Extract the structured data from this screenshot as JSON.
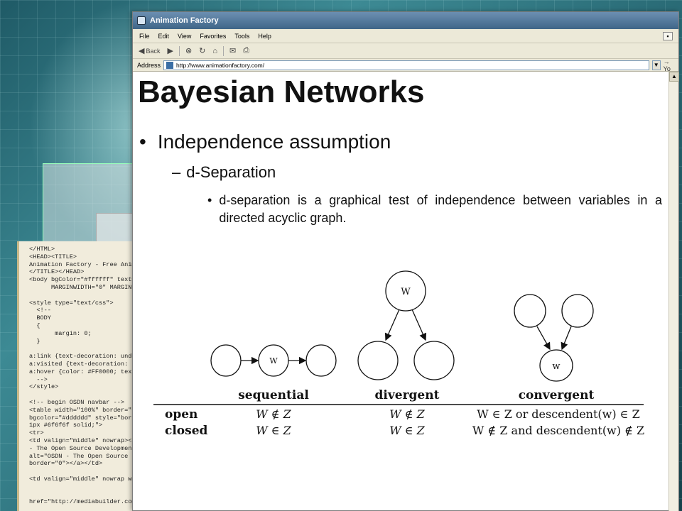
{
  "browser": {
    "window_title": "Animation Factory",
    "menu": [
      "File",
      "Edit",
      "View",
      "Favorites",
      "Tools",
      "Help"
    ],
    "toolbar": {
      "back_label": "Back"
    },
    "address_label": "Address",
    "address_value": "http://www.animationfactory.com/",
    "go_label": "Yo"
  },
  "code_panel": {
    "text": "</HTML>\n<HEAD><TITLE>\nAnimation Factory - Free Animat\n</TITLE></HEAD>\n<body bgColor=\"#ffffff\" text=\"\n      MARGINWIDTH=\"0\" MARGINH\n\n<style type=\"text/css\">\n  <!--\n  BODY\n  {\n       margin: 0;\n  }\n\na:link {text-decoration: under\na:visited {text-decoration: un\na:hover {color: #FF0000; text-\n  -->\n</style>\n\n<!-- begin OSDN navbar -->\n<table width=\"100%\" border=\"0\"\nbgcolor=\"#dddddd\" style=\"borde\n1px #6f6f6f solid;\">\n<tr>\n<td valign=\"middle\" nowrap><a h\n- The Open Source Development N\nalt=\"OSDN - The Open Source Dev\nborder=\"0\"></a></td>\n\n<td valign=\"middle\" nowrap wid\n\n\nhref=\"http://mediabuilder.com/"
  },
  "slide": {
    "title": "Bayesian Networks",
    "bullet_glyph": "•",
    "dash_glyph": "–",
    "level1": "Independence assumption",
    "level2": "d-Separation",
    "level3": "d-separation is a graphical test of independence between variables in a directed acyclic graph."
  },
  "diagram": {
    "node_label": "W",
    "node_label_small": "w",
    "columns": [
      "sequential",
      "divergent",
      "convergent"
    ],
    "rows": [
      {
        "label": "open",
        "cells": [
          "W ∉ Z",
          "W ∉ Z",
          "W ∈ Z or descendent(w) ∈ Z"
        ]
      },
      {
        "label": "closed",
        "cells": [
          "W ∈ Z",
          "W ∈ Z",
          "W ∉ Z and descendent(w) ∉ Z"
        ]
      }
    ]
  }
}
